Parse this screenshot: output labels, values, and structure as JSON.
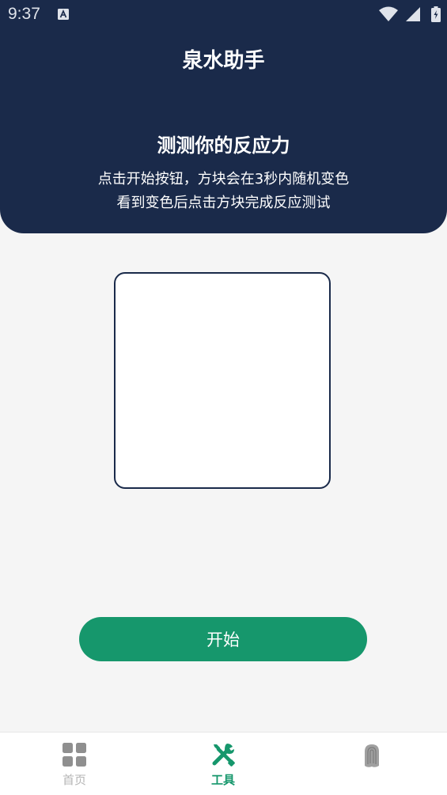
{
  "status_bar": {
    "time": "9:37",
    "icons": [
      "a-notification-icon",
      "wifi-icon",
      "signal-icon",
      "battery-icon"
    ]
  },
  "header": {
    "title": "泉水助手"
  },
  "test": {
    "title": "测测你的反应力",
    "description_line1": "点击开始按钮，方块会在3秒内随机变色",
    "description_line2": "看到变色后点击方块完成反应测试"
  },
  "start_button": {
    "label": "开始"
  },
  "nav": {
    "home_label": "首页",
    "tools_label": "工具",
    "active": "tools"
  },
  "colors": {
    "header_bg": "#1a2a4a",
    "accent": "#16976c",
    "page_bg": "#f5f5f5",
    "inactive": "#9a9a9a"
  }
}
